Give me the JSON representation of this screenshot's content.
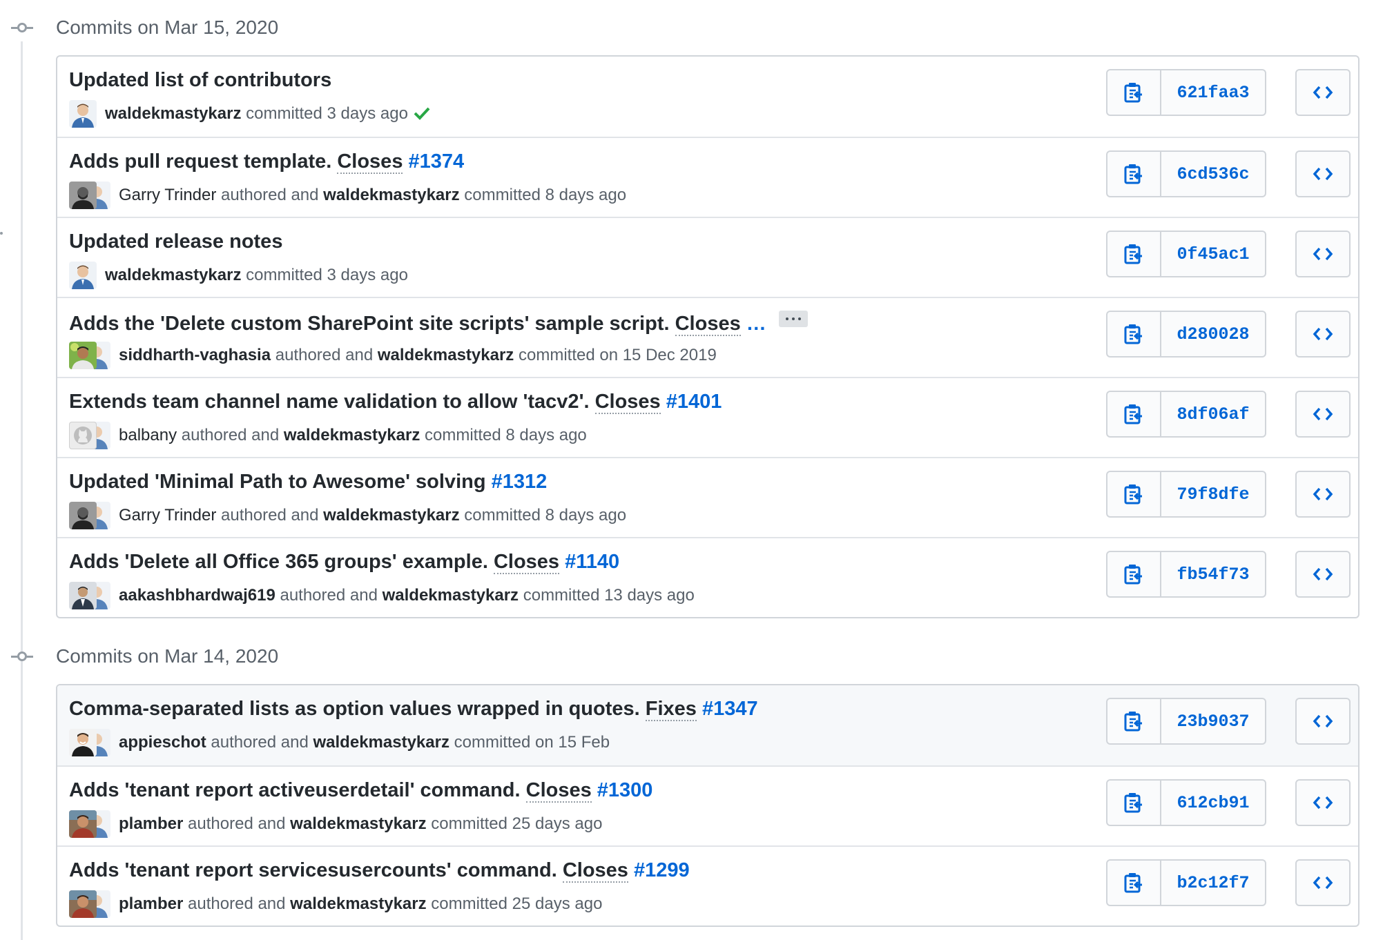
{
  "groups": [
    {
      "title": "Commits on Mar 15, 2020",
      "commits": [
        {
          "message": {
            "text": "Updated list of contributors"
          },
          "meta": {
            "committer": "waldekmastykarz",
            "text": "committed 3 days ago",
            "status": "success-check-icon"
          },
          "sha": "621faa3"
        },
        {
          "message": {
            "text": "Adds pull request template. ",
            "closes": "Closes",
            "issue": " #1374"
          },
          "meta": {
            "author": "Garry Trinder",
            "authored": " authored and ",
            "committer": "waldekmastykarz",
            "text": " committed 8 days ago"
          },
          "sha": "6cd536c"
        },
        {
          "message": {
            "text": "Updated release notes"
          },
          "meta": {
            "committer": "waldekmastykarz",
            "text": "committed 3 days ago"
          },
          "sha": "0f45ac1"
        },
        {
          "message": {
            "text": "Adds the 'Delete custom SharePoint site scripts' sample script. ",
            "closes": "Closes",
            "ellipsis": " …"
          },
          "meta": {
            "author": "siddharth-vaghasia",
            "authored": " authored and ",
            "committer": "waldekmastykarz",
            "text": " committed on 15 Dec 2019"
          },
          "sha": "d280028"
        },
        {
          "message": {
            "text": "Extends team channel name validation to allow 'tacv2'. ",
            "closes": "Closes",
            "issue": " #1401"
          },
          "meta": {
            "author": "balbany",
            "authored": " authored and ",
            "committer": "waldekmastykarz",
            "text": " committed 8 days ago"
          },
          "sha": "8df06af"
        },
        {
          "message": {
            "text": "Updated 'Minimal Path to Awesome' solving",
            "issue": " #1312"
          },
          "meta": {
            "author": "Garry Trinder",
            "authored": " authored and ",
            "committer": "waldekmastykarz",
            "text": " committed 8 days ago"
          },
          "sha": "79f8dfe"
        },
        {
          "message": {
            "text": "Adds 'Delete all Office 365 groups' example. ",
            "closes": "Closes",
            "issue": " #1140"
          },
          "meta": {
            "author": "aakashbhardwaj619",
            "authored": " authored and ",
            "committer": "waldekmastykarz",
            "text": " committed 13 days ago"
          },
          "sha": "fb54f73"
        }
      ]
    },
    {
      "title": "Commits on Mar 14, 2020",
      "commits": [
        {
          "message": {
            "text": "Comma-separated lists as option values wrapped in quotes. ",
            "closes": "Fixes",
            "issue": " #1347"
          },
          "meta": {
            "author": "appieschot",
            "authored": " authored and ",
            "committer": "waldekmastykarz",
            "text": " committed on 15 Feb"
          },
          "sha": "23b9037"
        },
        {
          "message": {
            "text": "Adds 'tenant report activeuserdetail' command. ",
            "closes": "Closes",
            "issue": " #1300"
          },
          "meta": {
            "author": "plamber",
            "authored": " authored and ",
            "committer": "waldekmastykarz",
            "text": " committed 25 days ago"
          },
          "sha": "612cb91"
        },
        {
          "message": {
            "text": "Adds 'tenant report servicesusercounts' command. ",
            "closes": "Closes",
            "issue": " #1299"
          },
          "meta": {
            "author": "plamber",
            "authored": " authored and ",
            "committer": "waldekmastykarz",
            "text": " committed 25 days ago"
          },
          "sha": "b2c12f7"
        }
      ]
    }
  ],
  "colors": {
    "link": "#0366d6",
    "success": "#28a745",
    "muted": "#586069",
    "border": "#d1d5da"
  },
  "icons": {
    "copy": "clippy-icon",
    "browse": "code-icon",
    "timeline": "git-commit-icon"
  }
}
